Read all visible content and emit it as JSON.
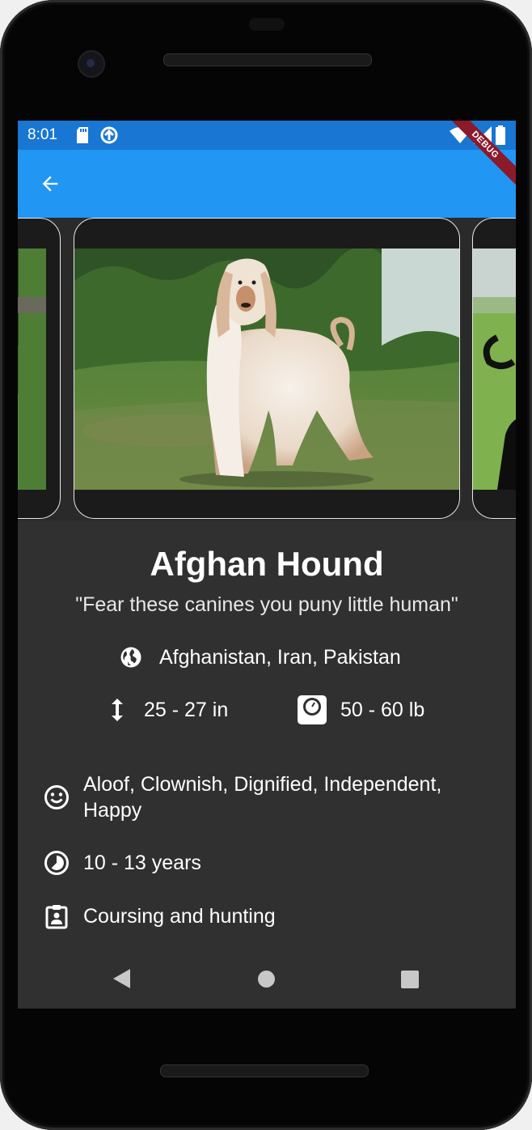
{
  "status_bar": {
    "time": "8:01",
    "icons": [
      "sd-card-icon",
      "sync-icon",
      "wifi-icon",
      "signal-icon",
      "battery-icon"
    ]
  },
  "debug_banner": "DEBUG",
  "app_bar": {
    "back_icon": "arrow-back-icon",
    "color": "#2196f3",
    "status_color": "#1976d2"
  },
  "breed": {
    "name": "Afghan Hound",
    "tagline": "\"Fear these canines you puny little human\"",
    "origin": "Afghanistan, Iran, Pakistan",
    "height": "25 - 27 in",
    "weight": "50 - 60 lb",
    "temperament": "Aloof, Clownish, Dignified, Independent, Happy",
    "life_span": "10 - 13 years",
    "bred_for": "Coursing and hunting"
  },
  "colors": {
    "details_bg": "#303030",
    "text": "#ffffff"
  }
}
